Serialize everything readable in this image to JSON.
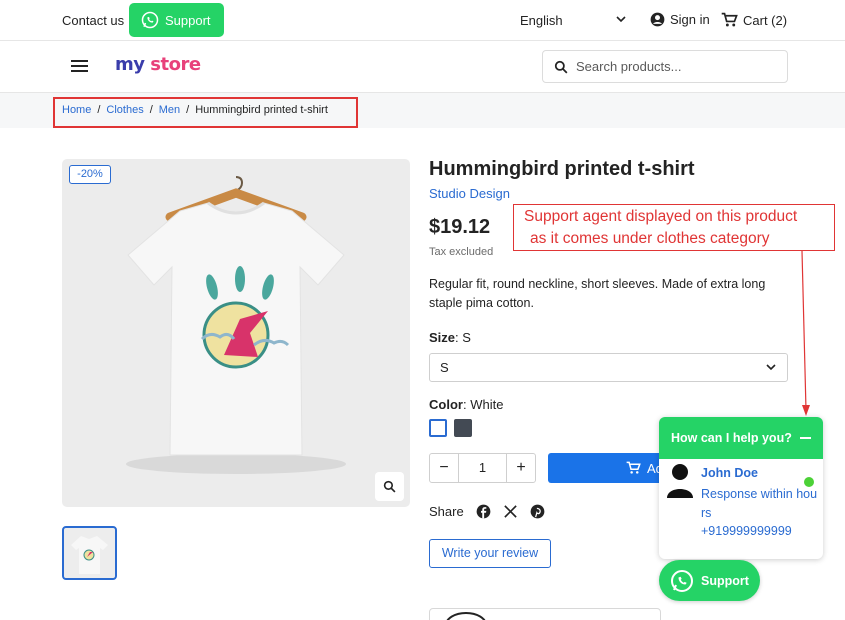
{
  "topbar": {
    "contact_label": "Contact us",
    "support_label": "Support",
    "language": "English",
    "signin_label": "Sign in",
    "cart_label": "Cart (2)"
  },
  "header": {
    "logo_part1": "my",
    "logo_part2": "store",
    "search_placeholder": "Search products..."
  },
  "breadcrumb": [
    "Home",
    "Clothes",
    "Men",
    "Hummingbird printed t-shirt"
  ],
  "product": {
    "discount": "-20%",
    "title": "Hummingbird printed t-shirt",
    "brand": "Studio Design",
    "price": "$19.12",
    "tax_note": "Tax excluded",
    "description": "Regular fit, round neckline, short sleeves. Made of extra long staple pima cotton.",
    "size_label": "Size",
    "size_value": "S",
    "size_selected": "S",
    "color_label": "Color",
    "color_value": "White",
    "colors": [
      "#ffffff",
      "#434a54"
    ],
    "quantity": "1",
    "add_to_cart_label": "Add to cart",
    "share_label": "Share",
    "review_label": "Write your review"
  },
  "annotation": {
    "line1": "Support agent displayed on this product",
    "line2": "as it comes under clothes category"
  },
  "widget": {
    "header": "How can I help you?",
    "agent_name": "John Doe",
    "agent_response": "Response within hours",
    "agent_phone": "+919999999999",
    "support_button": "Support"
  },
  "colors": {
    "whatsapp_green": "#25d366",
    "link_blue": "#2a6bd1",
    "primary_blue": "#1a73e8",
    "annotation_red": "#e03535"
  }
}
